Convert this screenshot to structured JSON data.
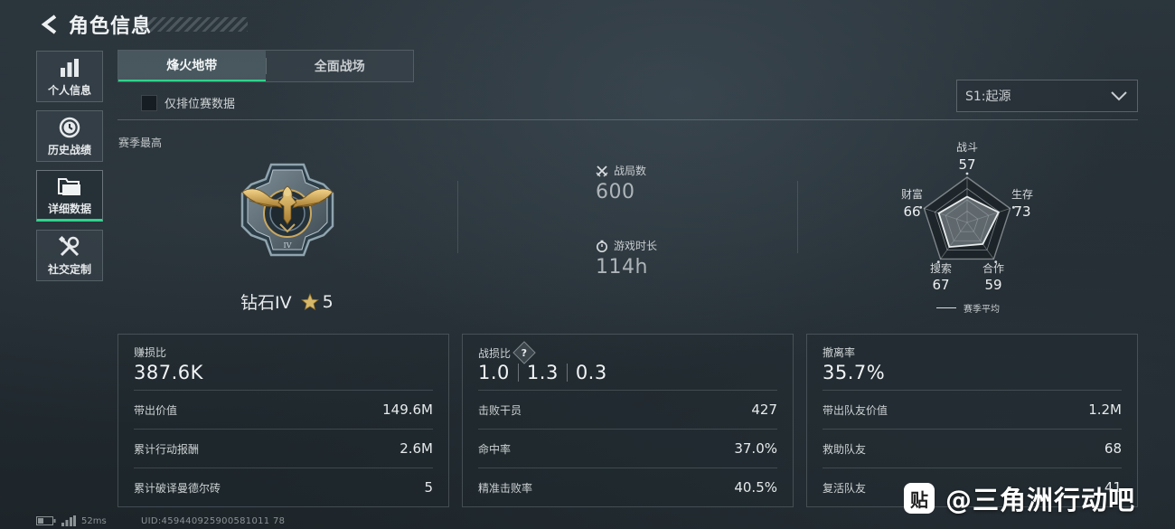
{
  "header": {
    "title": "角色信息"
  },
  "sidebar": {
    "items": [
      {
        "label": "个人信息",
        "icon": "bar-chart-icon",
        "active": false
      },
      {
        "label": "历史战绩",
        "icon": "history-clock-icon",
        "active": false
      },
      {
        "label": "详细数据",
        "icon": "folder-icon",
        "active": true
      },
      {
        "label": "社交定制",
        "icon": "tools-icon",
        "active": false
      }
    ]
  },
  "tabs": [
    {
      "label": "烽火地带",
      "active": true
    },
    {
      "label": "全面战场",
      "active": false
    }
  ],
  "filter": {
    "ranked_only_label": "仅排位赛数据",
    "checked": false
  },
  "season_select": {
    "value": "S1:起源"
  },
  "season_best": {
    "label": "赛季最高",
    "rank_name": "钻石IV",
    "stars": "5"
  },
  "stats": {
    "matches_label": "战局数",
    "matches_value": "600",
    "playtime_label": "游戏时长",
    "playtime_value": "114h"
  },
  "radar": {
    "axes": [
      {
        "label": "战斗",
        "value": "57"
      },
      {
        "label": "生存",
        "value": "73"
      },
      {
        "label": "合作",
        "value": "59"
      },
      {
        "label": "搜索",
        "value": "67"
      },
      {
        "label": "财富",
        "value": "66"
      }
    ],
    "legend": "赛季平均"
  },
  "cards": {
    "profit": {
      "title": "赚损比",
      "main": "387.6K",
      "rows": [
        {
          "label": "带出价值",
          "value": "149.6M"
        },
        {
          "label": "累计行动报酬",
          "value": "2.6M"
        },
        {
          "label": "累计破译曼德尔砖",
          "value": "5"
        }
      ]
    },
    "combat": {
      "title": "战损比",
      "help": "?",
      "kda": [
        "1.0",
        "1.3",
        "0.3"
      ],
      "rows": [
        {
          "label": "击败干员",
          "value": "427"
        },
        {
          "label": "命中率",
          "value": "37.0%"
        },
        {
          "label": "精准击败率",
          "value": "40.5%"
        }
      ]
    },
    "extract": {
      "title": "撤离率",
      "main": "35.7%",
      "rows": [
        {
          "label": "带出队友价值",
          "value": "1.2M"
        },
        {
          "label": "救助队友",
          "value": "68"
        },
        {
          "label": "复活队友",
          "value": "41"
        }
      ]
    }
  },
  "status": {
    "ping": "52ms",
    "uid": "UID:459440925900581011 78"
  },
  "watermark": {
    "text": "@三角洲行动吧",
    "logo": "贴"
  },
  "colors": {
    "accent": "#2fd48c"
  }
}
